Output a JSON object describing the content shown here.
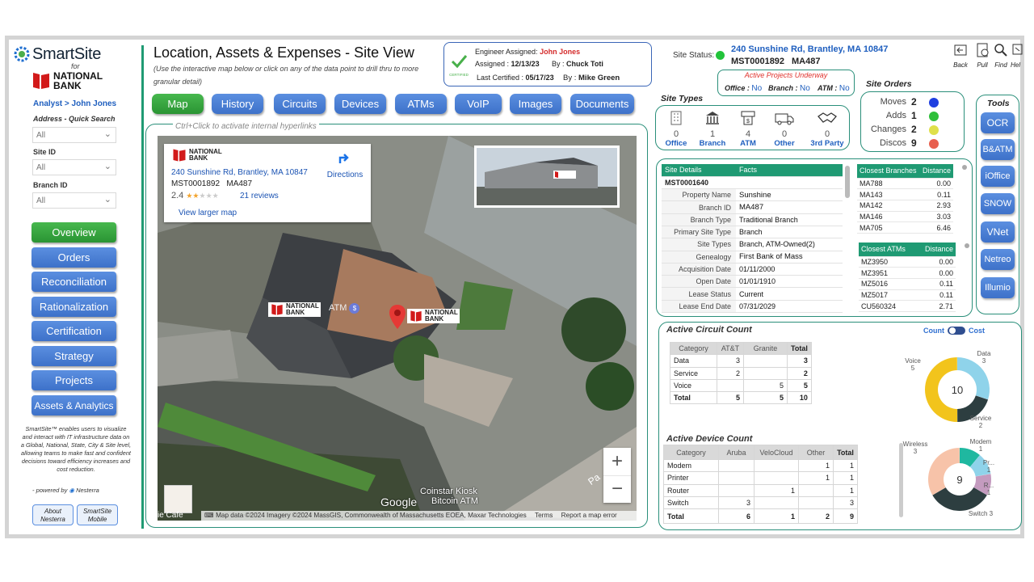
{
  "brand": {
    "name": "SmartSite",
    "for": "for",
    "bank_line1": "NATIONAL",
    "bank_line2": "BANK",
    "analyst": "Analyst > John Jones"
  },
  "filters": {
    "quick_search": "Address - Quick Search",
    "address_value": "All",
    "site_id_label": "Site ID",
    "site_id_value": "All",
    "branch_id_label": "Branch ID",
    "branch_id_value": "All"
  },
  "nav": [
    "Overview",
    "Orders",
    "Reconciliation",
    "Rationalization",
    "Certification",
    "Strategy",
    "Projects",
    "Assets & Analytics"
  ],
  "footer": {
    "desc": "SmartSite™ enables users to visualize and interact with IT infrastructure data on a Global, National, State, City & Site level, allowing teams to make fast and confident decisions toward efficiency increases and cost reduction.",
    "powered": "- powered by",
    "powered_brand": "Nesterra",
    "about": "About Nesterra",
    "mobile": "SmartSite Mobile"
  },
  "header": {
    "title": "Location, Assets & Expenses - Site View",
    "subtitle": "(Use the interactive map below or click on any of the data point to drill thru to more granular detail)"
  },
  "engineer": {
    "assigned_label": "Engineer Assigned:",
    "assigned_name": "John Jones",
    "assigned_on_label": "Assigned :",
    "assigned_on": "12/13/23",
    "by_label": "By :",
    "assigned_by": "Chuck Toti",
    "certified_label": "Last Certified :",
    "certified_on": "05/17/23",
    "by2_label": "By :",
    "certified_by": "Mike Green",
    "badge": "CERTIFIED"
  },
  "site_status": {
    "label": "Site Status:",
    "color": "#22c33a",
    "address": "240 Sunshine Rd, Brantley, MA 10847",
    "id": "MST0001892",
    "branch": "MA487"
  },
  "active_projects": {
    "title": "Active Projects Underway",
    "office_label": "Office :",
    "office": "No",
    "branch_label": "Branch :",
    "branch": "No",
    "atm_label": "ATM :",
    "atm": "No"
  },
  "top_tools": [
    {
      "icon": "back-icon",
      "label": "Back"
    },
    {
      "icon": "pull-icon",
      "label": "Pull"
    },
    {
      "icon": "find-icon",
      "label": "Find"
    },
    {
      "icon": "help-icon",
      "label": "Hel"
    }
  ],
  "tabs": [
    "Map",
    "History",
    "Circuits",
    "Devices",
    "ATMs",
    "VoIP",
    "Images",
    "Documents"
  ],
  "map": {
    "hint": "Ctrl+Click to activate internal hyperlinks",
    "card_address": "240 Sunshine Rd, Brantley, MA 10847",
    "card_ids": "MST0001892   MA487",
    "rating": "2.4",
    "stars": 2.4,
    "reviews": "21 reviews",
    "directions": "Directions",
    "larger": "View larger map",
    "pin_label1": "NATIONAL",
    "pin_label2": "BANK",
    "atm_text": "ATM",
    "kiosk1": "Coinstar Kiosk",
    "kiosk2": "Bitcoin ATM",
    "google": "Google",
    "attribution": "Map data ©2024 Imagery ©2024 MassGIS, Commonwealth of Massachusetts EOEA, Maxar Technologies",
    "terms": "Terms",
    "report": "Report a map error",
    "cafe": "ie Cafe",
    "road": "Pa",
    "zoom_in": "+",
    "zoom_out": "−"
  },
  "site_types": {
    "title": "Site Types",
    "items": [
      {
        "icon": "office-icon",
        "count": "0",
        "label": "Office"
      },
      {
        "icon": "branch-icon",
        "count": "1",
        "label": "Branch"
      },
      {
        "icon": "atm-icon",
        "count": "4",
        "label": "ATM"
      },
      {
        "icon": "other-icon",
        "count": "0",
        "label": "Other"
      },
      {
        "icon": "handshake-icon",
        "count": "0",
        "label": "3rd Party"
      }
    ]
  },
  "site_orders": {
    "title": "Site Orders",
    "items": [
      {
        "label": "Moves",
        "value": "2",
        "color": "#1f3fe0"
      },
      {
        "label": "Adds",
        "value": "1",
        "color": "#2fbf3a"
      },
      {
        "label": "Changes",
        "value": "2",
        "color": "#dfe04a"
      },
      {
        "label": "Discos",
        "value": "9",
        "color": "#e8604f"
      }
    ]
  },
  "tools": {
    "title": "Tools",
    "items": [
      "OCR",
      "B&ATM",
      "iOffice",
      "SNOW",
      "VNet",
      "Netreo",
      "Illumio"
    ]
  },
  "site_details": {
    "col1": "Site Details",
    "col2": "Facts",
    "site_id": "MST0001640",
    "rows": [
      {
        "k": "Property Name",
        "v": "Sunshine"
      },
      {
        "k": "Branch ID",
        "v": "MA487"
      },
      {
        "k": "Branch Type",
        "v": "Traditional Branch"
      },
      {
        "k": "Primary Site Type",
        "v": "Branch"
      },
      {
        "k": "Site Types",
        "v": "Branch, ATM-Owned(2)"
      },
      {
        "k": "Genealogy",
        "v": "First Bank of Mass"
      },
      {
        "k": "Acquisition Date",
        "v": "01/11/2000"
      },
      {
        "k": "Open Date",
        "v": "01/01/1910"
      },
      {
        "k": "Lease Status",
        "v": "Current"
      },
      {
        "k": "Lease End Date",
        "v": "07/31/2029"
      }
    ]
  },
  "closest_branches": {
    "col1": "Closest Branches",
    "col2": "Distance",
    "rows": [
      [
        "MA788",
        "0.00"
      ],
      [
        "MA143",
        "0.11"
      ],
      [
        "MA142",
        "2.93"
      ],
      [
        "MA146",
        "3.03"
      ],
      [
        "MA705",
        "6.46"
      ]
    ]
  },
  "closest_atms": {
    "col1": "Closest ATMs",
    "col2": "Distance",
    "rows": [
      [
        "MZ3950",
        "0.00"
      ],
      [
        "MZ3951",
        "0.00"
      ],
      [
        "MZ5016",
        "0.11"
      ],
      [
        "MZ5017",
        "0.11"
      ],
      [
        "CU560324",
        "2.71"
      ]
    ]
  },
  "circuit": {
    "title": "Active Circuit Count",
    "toggle_count": "Count",
    "toggle_cost": "Cost",
    "headers": [
      "Category",
      "AT&T",
      "Granite",
      "Total"
    ],
    "rows": [
      [
        "Data",
        "3",
        "",
        "3"
      ],
      [
        "Service",
        "2",
        "",
        "2"
      ],
      [
        "Voice",
        "",
        "5",
        "5"
      ]
    ],
    "total": [
      "Total",
      "5",
      "5",
      "10"
    ]
  },
  "device": {
    "title": "Active Device Count",
    "headers": [
      "Category",
      "Aruba",
      "VeloCloud",
      "Other",
      "Total"
    ],
    "rows": [
      [
        "Modem",
        "",
        "",
        "1",
        "1"
      ],
      [
        "Printer",
        "",
        "",
        "1",
        "1"
      ],
      [
        "Router",
        "",
        "1",
        "",
        "1"
      ],
      [
        "Switch",
        "3",
        "",
        "",
        "3"
      ]
    ],
    "total": [
      "Total",
      "6",
      "1",
      "2",
      "9"
    ]
  },
  "chart_data": [
    {
      "type": "pie",
      "title": "",
      "center_label": "10",
      "categories": [
        "Data",
        "Service",
        "Voice"
      ],
      "values": [
        3,
        2,
        5
      ],
      "colors": [
        "#8fd3ea",
        "#2d3e40",
        "#f2c41c"
      ]
    },
    {
      "type": "pie",
      "title": "",
      "center_label": "9",
      "categories": [
        "Modem",
        "Printer",
        "Router",
        "Switch",
        "Wireless"
      ],
      "values": [
        1,
        1,
        1,
        3,
        3
      ],
      "colors": [
        "#1fb8a0",
        "#8fd3ea",
        "#c49bbf",
        "#2d3e40",
        "#f7c3a9"
      ],
      "slice_labels": [
        "Modem\n1",
        "Pr...\n1",
        "R...\n1",
        "Switch 3",
        "Wireless\n3"
      ]
    }
  ]
}
